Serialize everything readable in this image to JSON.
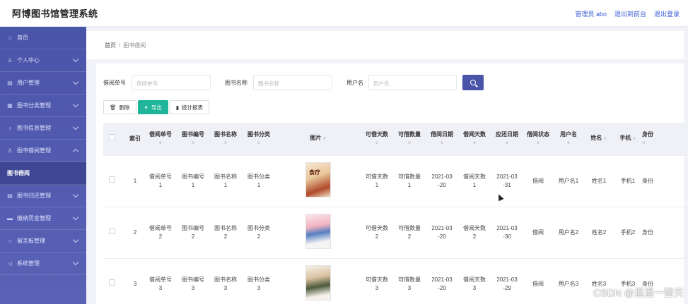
{
  "app": {
    "title": "阿博图书馆管理系统"
  },
  "topbar": {
    "admin": "管理员 abo",
    "front": "退出到前台",
    "logout": "退出登录"
  },
  "sidebar": {
    "items": [
      {
        "label": "首页",
        "icon": "home-icon",
        "expandable": false
      },
      {
        "label": "个人中心",
        "icon": "person-icon",
        "expandable": true
      },
      {
        "label": "用户管理",
        "icon": "user-icon",
        "expandable": true
      },
      {
        "label": "图书分类管理",
        "icon": "category-icon",
        "expandable": true
      },
      {
        "label": "图书信息管理",
        "icon": "book-icon",
        "expandable": true
      },
      {
        "label": "图书借阅管理",
        "icon": "borrow-icon",
        "expandable": true,
        "expanded": true
      },
      {
        "label": "图书借阅",
        "sub": true
      },
      {
        "label": "图书归还管理",
        "icon": "return-icon",
        "expandable": true
      },
      {
        "label": "缴纳罚金管理",
        "icon": "fine-icon",
        "expandable": true
      },
      {
        "label": "留言板管理",
        "icon": "message-icon",
        "expandable": true
      },
      {
        "label": "系统管理",
        "icon": "settings-icon",
        "expandable": true
      }
    ]
  },
  "breadcrumb": {
    "home": "首页",
    "sep": "/",
    "current": "图书借阅"
  },
  "search": {
    "borrow_no_label": "借阅单号",
    "borrow_no_placeholder": "借阅单号",
    "book_name_label": "图书名称",
    "book_name_placeholder": "图书名称",
    "username_label": "用户名",
    "username_placeholder": "用户名"
  },
  "toolbar": {
    "delete": "删除",
    "export": "导出",
    "stats": "统计报表"
  },
  "table": {
    "headers": {
      "index": "索引",
      "borrow_no": "借阅单号",
      "book_no": "图书编号",
      "book_name": "图书名称",
      "book_cat": "图书分类",
      "image": "图片",
      "can_days": "可借天数",
      "can_qty": "可借数量",
      "borrow_date": "借阅日期",
      "borrow_days": "借阅天数",
      "due_date": "应还日期",
      "status": "借阅状态",
      "username": "用户名",
      "name": "姓名",
      "phone": "手机",
      "idcard": "身份"
    },
    "sort_glyph": "≎",
    "rows": [
      {
        "index": "1",
        "borrow_no": "借阅单号\n1",
        "book_no": "图书编号\n1",
        "book_name": "图书名称\n1",
        "book_cat": "图书分类\n1",
        "cover_title": "食疗",
        "can_days": "可借天数\n1",
        "can_qty": "可借数量\n1",
        "borrow_date": "2021-03\n-20",
        "borrow_days": "借阅天数\n1",
        "due_date": "2021-03\n-31",
        "status": "借阅",
        "username": "用户名1",
        "name": "姓名1",
        "phone": "手机1",
        "idcard": "身份"
      },
      {
        "index": "2",
        "borrow_no": "借阅单号\n2",
        "book_no": "图书编号\n2",
        "book_name": "图书名称\n2",
        "book_cat": "图书分类\n2",
        "cover_title": "",
        "can_days": "可借天数\n2",
        "can_qty": "可借数量\n2",
        "borrow_date": "2021-03\n-20",
        "borrow_days": "借阅天数\n2",
        "due_date": "2021-03\n-30",
        "status": "借阅",
        "username": "用户名2",
        "name": "姓名2",
        "phone": "手机2",
        "idcard": "身份"
      },
      {
        "index": "3",
        "borrow_no": "借阅单号\n3",
        "book_no": "图书编号\n3",
        "book_name": "图书名称\n3",
        "book_cat": "图书分类\n3",
        "cover_title": "",
        "can_days": "可借天数\n3",
        "can_qty": "可借数量\n3",
        "borrow_date": "2021-03\n-20",
        "borrow_days": "借阅天数\n3",
        "due_date": "2021-03\n-29",
        "status": "借阅",
        "username": "用户名3",
        "name": "姓名3",
        "phone": "手机3",
        "idcard": "身份"
      }
    ]
  },
  "watermark": "CSDN @混混一整天"
}
